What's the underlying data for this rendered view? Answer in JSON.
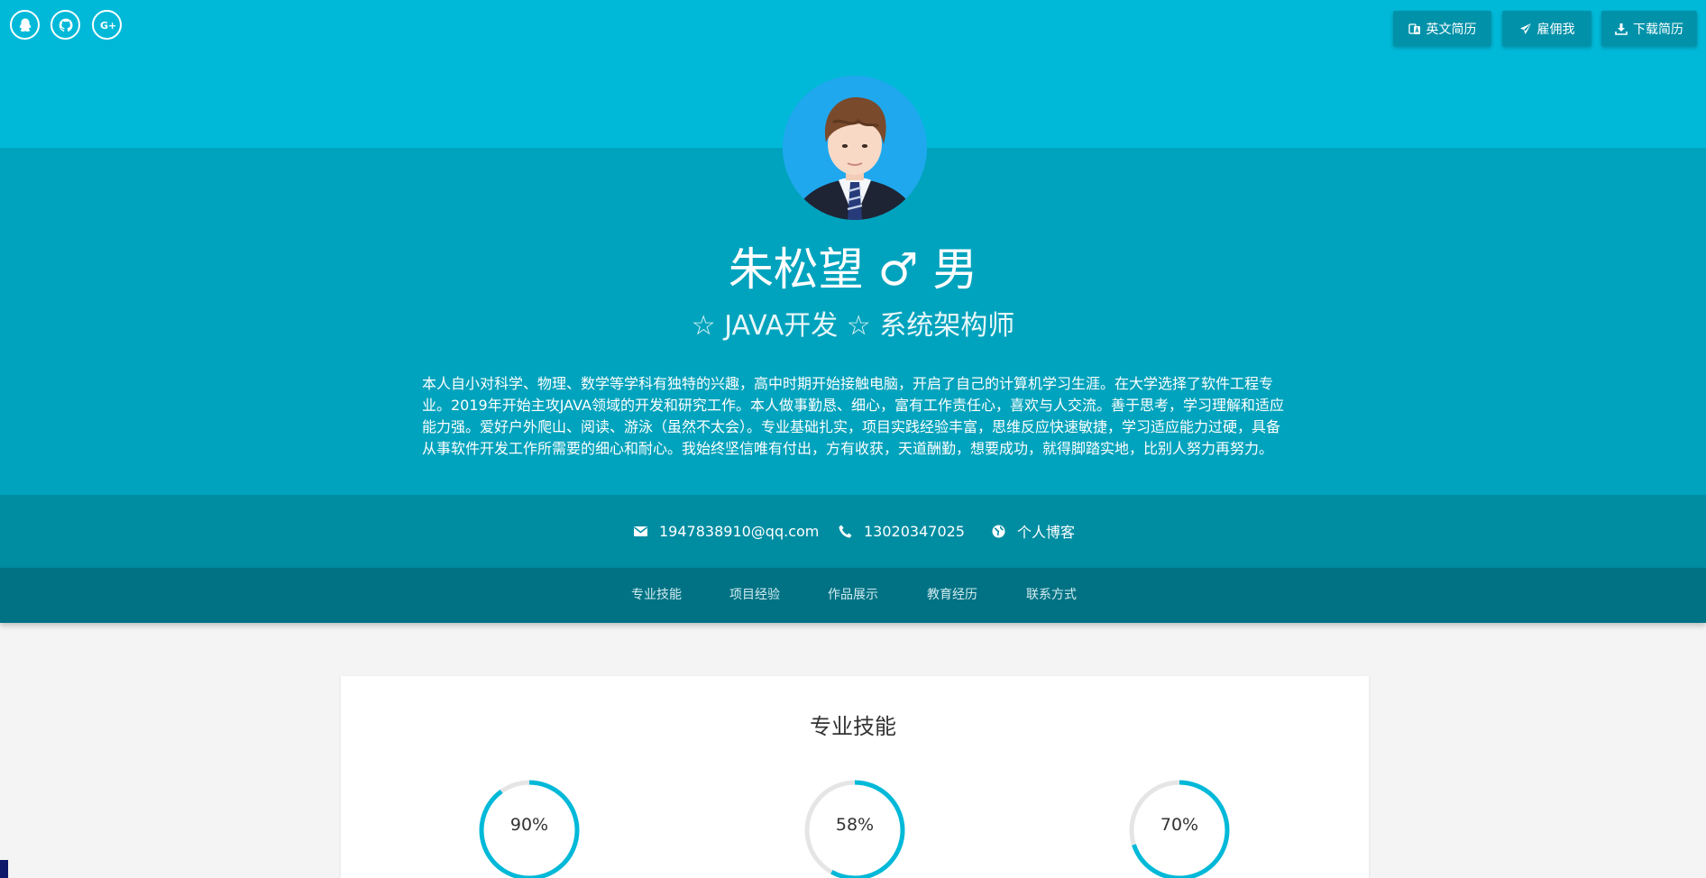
{
  "social": [
    {
      "icon": "qq-icon"
    },
    {
      "icon": "github-icon"
    },
    {
      "icon": "google-plus-icon"
    }
  ],
  "top_buttons": {
    "english_resume": "英文简历",
    "hire_me": "雇佣我",
    "download_resume": "下载简历"
  },
  "profile": {
    "name": "朱松望 ♂ 男",
    "subtitle": "☆ JAVA开发 ☆ 系统架构师",
    "bio": "本人自小对科学、物理、数学等学科有独特的兴趣，高中时期开始接触电脑，开启了自己的计算机学习生涯。在大学选择了软件工程专业。2019年开始主攻JAVA领域的开发和研究工作。本人做事勤恳、细心，富有工作责任心，喜欢与人交流。善于思考，学习理解和适应能力强。爱好户外爬山、阅读、游泳（虽然不太会）。专业基础扎实，项目实践经验丰富，思维反应快速敏捷，学习适应能力过硬，具备从事软件开发工作所需要的细心和耐心。我始终坚信唯有付出，方有收获，天道酬勤，想要成功，就得脚踏实地，比别人努力再努力。"
  },
  "contact": {
    "email": "1947838910@qq.com",
    "phone": "13020347025",
    "blog": "个人博客"
  },
  "nav": [
    "专业技能",
    "项目经验",
    "作品展示",
    "教育经历",
    "联系方式"
  ],
  "skills_section": {
    "title": "专业技能",
    "skills": [
      {
        "label": "90%",
        "value": 0.9
      },
      {
        "label": "58%",
        "value": 0.58
      },
      {
        "label": "70%",
        "value": 0.7
      }
    ]
  },
  "colors": {
    "top_band": "#00b9d8",
    "hero": "#00a3bd",
    "contact_bar": "#008da2",
    "nav_bar": "#007284",
    "accent": "#00b9d8",
    "ring_track": "#e5e5e5"
  }
}
